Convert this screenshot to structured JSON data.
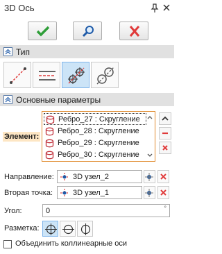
{
  "window": {
    "title": "3D Ось"
  },
  "actions": {
    "ok": "ok-checkmark",
    "preview": "preview-magnifier",
    "cancel": "cancel-cross"
  },
  "sections": {
    "type": {
      "label": "Тип"
    },
    "params": {
      "label": "Основные параметры"
    }
  },
  "type_options": [
    {
      "name": "line-through-two-points",
      "active": false
    },
    {
      "name": "parallel-lines",
      "active": false
    },
    {
      "name": "through-points-pair",
      "active": true
    },
    {
      "name": "between-two-circles",
      "active": false
    }
  ],
  "element": {
    "label": "Элемент:",
    "items": [
      "Ребро_27 : Скругление",
      "Ребро_28 : Скругление",
      "Ребро_29 : Скругление",
      "Ребро_30 : Скругление"
    ]
  },
  "direction": {
    "label": "Направление:",
    "value": "3D узел_2"
  },
  "second_point": {
    "label": "Вторая точка:",
    "value": "3D узел_1"
  },
  "angle": {
    "label": "Угол:",
    "value": "0",
    "unit": "°"
  },
  "marking": {
    "label": "Разметка:"
  },
  "collinear": {
    "label": "Объединить коллинеарные оси",
    "checked": false
  },
  "colors": {
    "accent_red": "#e03a3a",
    "accent_green": "#2e9e38",
    "selection_blue": "#cce4f7",
    "section_bg": "#e1e1e1",
    "highlight_orange": "#e08a2c"
  }
}
